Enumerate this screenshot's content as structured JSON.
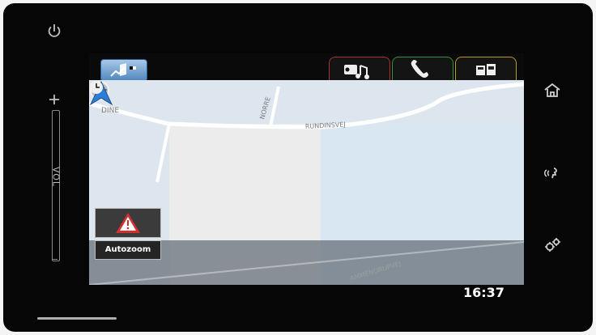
{
  "device": {
    "left_controls": {
      "volume_label": "VOL",
      "power_icon": "power-icon",
      "volume_up_icon": "plus-icon",
      "volume_down_icon": "minus-icon"
    },
    "right_controls": [
      {
        "name": "home-icon"
      },
      {
        "name": "voice-icon"
      },
      {
        "name": "settings-icon"
      }
    ]
  },
  "top_tabs": [
    {
      "name": "navigation-tab-icon",
      "color": "#4f85bd"
    },
    {
      "name": "camera-audio-tab-icon",
      "color": "#a33333"
    },
    {
      "name": "phone-tab-icon",
      "color": "#3c8f3c"
    },
    {
      "name": "apps-tab-icon",
      "color": "#b79a24"
    }
  ],
  "map": {
    "roads": [
      "DINE",
      "NORRE",
      "RUNDINSVEJ",
      "AMMENDRUPVEJ"
    ],
    "autozoom_label": "Autozoom",
    "alert_icon": "warning-icon",
    "time": "16:37"
  }
}
